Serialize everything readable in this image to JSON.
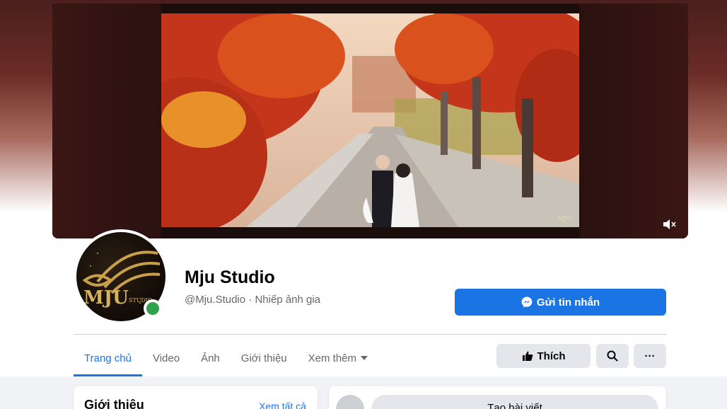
{
  "page": {
    "name": "Mju Studio",
    "handle": "@Mju.Studio",
    "separator": "·",
    "category": "Nhiếp ảnh gia",
    "avatar_text": "MJU",
    "avatar_subtext": "STUDIO",
    "cover_watermark": "MJU"
  },
  "actions": {
    "message_label": "Gửi tin nhắn",
    "like_label": "Thích",
    "more_label": "···"
  },
  "tabs": [
    {
      "label": "Trang chủ",
      "active": true
    },
    {
      "label": "Video"
    },
    {
      "label": "Ảnh"
    },
    {
      "label": "Giới thiệu"
    },
    {
      "label": "Xem thêm"
    }
  ],
  "intro": {
    "title": "Giới thiệu",
    "see_all": "Xem tất cả"
  },
  "composer": {
    "button_label": "Tạo bài viết"
  },
  "colors": {
    "accent": "#1b74e4",
    "online": "#31a24c",
    "gold": "#c9a04a"
  }
}
